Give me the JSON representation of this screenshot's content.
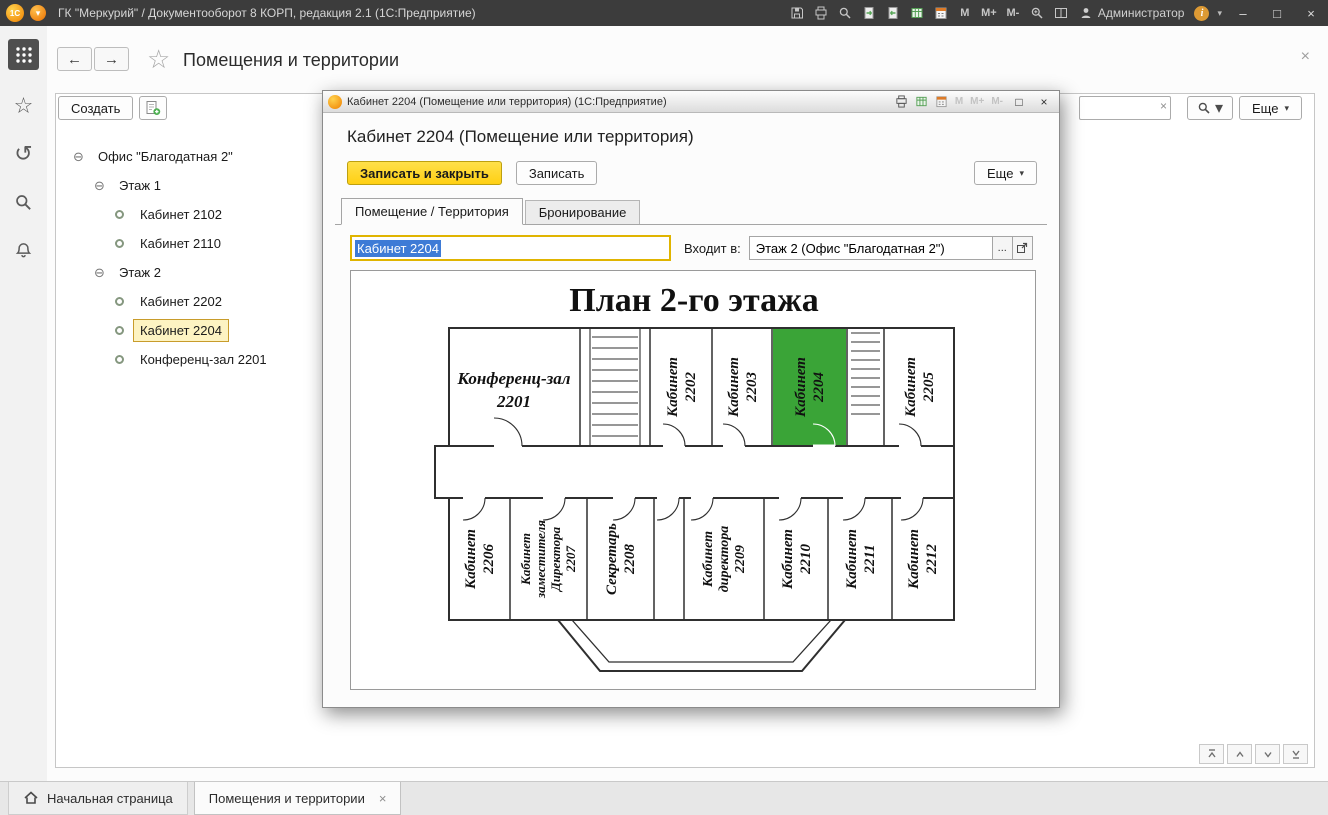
{
  "colors": {
    "accent_yellow": "#ffd013",
    "selection_blue": "#3e7bd6",
    "room_green": "#3aa437",
    "titlebar_bg": "#3c3c3c"
  },
  "icons": {
    "back": "←",
    "forward": "→",
    "star": "☆",
    "dropdown": "▾",
    "close": "×",
    "minimize": "–",
    "maximize": "□",
    "clear": "×",
    "ellipsis": "...",
    "expanded": "⊖",
    "info": "i",
    "history": "↺"
  },
  "titlebar": {
    "logo": "1С",
    "title": "ГК \"Меркурий\" / Документооборот 8 КОРП, редакция 2.1  (1С:Предприятие)",
    "memory": [
      "M",
      "M+",
      "M-"
    ],
    "user": "Администратор"
  },
  "page": {
    "title": "Помещения и территории",
    "toolbar": {
      "create": "Создать",
      "more": "Еще",
      "search_value": ""
    }
  },
  "tree": {
    "items": [
      {
        "label": "Офис \"Благодатная 2\"",
        "type": "group",
        "selected": false
      },
      {
        "label": "Этаж 1",
        "type": "group",
        "selected": false
      },
      {
        "label": "Кабинет 2102",
        "type": "leaf",
        "selected": false
      },
      {
        "label": "Кабинет 2110",
        "type": "leaf",
        "selected": false
      },
      {
        "label": "Этаж 2",
        "type": "group",
        "selected": false
      },
      {
        "label": "Кабинет 2202",
        "type": "leaf",
        "selected": false
      },
      {
        "label": "Кабинет 2204",
        "type": "leaf",
        "selected": true
      },
      {
        "label": "Конференц-зал 2201",
        "type": "leaf",
        "selected": false
      }
    ]
  },
  "dialog": {
    "window_title": "Кабинет 2204 (Помещение или территория)  (1С:Предприятие)",
    "header": "Кабинет 2204 (Помещение или территория)",
    "memory": [
      "M",
      "M+",
      "M-"
    ],
    "buttons": {
      "save_close": "Записать и закрыть",
      "save": "Записать",
      "more": "Еще"
    },
    "tabs": [
      {
        "label": "Помещение / Территория",
        "active": true
      },
      {
        "label": "Бронирование",
        "active": false
      }
    ],
    "fields": {
      "name_value": "Кабинет 2204",
      "parent_label": "Входит в:",
      "parent_value": "Этаж 2 (Офис \"Благодатная 2\")"
    }
  },
  "plan": {
    "title": "План 2-го этажа",
    "highlight_color": "#3aa437",
    "rooms_top": [
      {
        "lines": [
          "Конференц-зал",
          "2201"
        ]
      },
      {
        "lines": [
          "Кабинет",
          "2202"
        ]
      },
      {
        "lines": [
          "Кабинет",
          "2203"
        ]
      },
      {
        "lines": [
          "Кабинет",
          "2204"
        ],
        "highlighted": true
      },
      {
        "lines": [
          "Кабинет",
          "2205"
        ]
      }
    ],
    "rooms_bottom": [
      {
        "lines": [
          "Кабинет",
          "2206"
        ]
      },
      {
        "lines": [
          "Кабинет",
          "заместителя",
          "Директора",
          "2207"
        ]
      },
      {
        "lines": [
          "Секретарь",
          "2208"
        ]
      },
      {
        "lines": [
          "Кабинет",
          "директора",
          "2209"
        ]
      },
      {
        "lines": [
          "Кабинет",
          "2210"
        ]
      },
      {
        "lines": [
          "Кабинет",
          "2211"
        ]
      },
      {
        "lines": [
          "Кабинет",
          "2212"
        ]
      }
    ]
  },
  "bottom_bar": {
    "home_tab": "Начальная страница",
    "tabs": [
      {
        "label": "Помещения и территории",
        "active": true
      }
    ]
  }
}
